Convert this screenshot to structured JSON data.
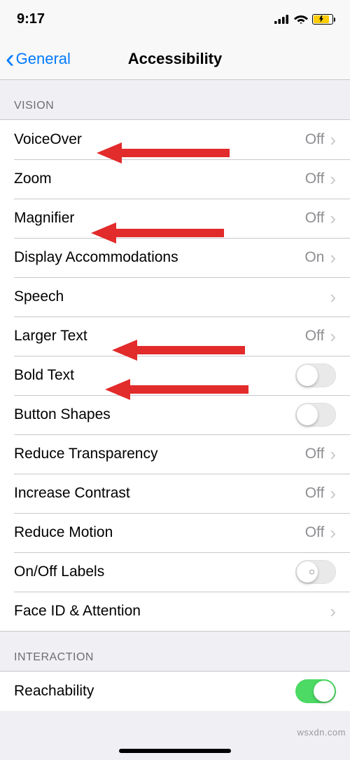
{
  "status": {
    "time": "9:17"
  },
  "nav": {
    "back": "General",
    "title": "Accessibility"
  },
  "sections": {
    "vision": {
      "header": "VISION",
      "voiceover": {
        "label": "VoiceOver",
        "value": "Off"
      },
      "zoom": {
        "label": "Zoom",
        "value": "Off"
      },
      "magnifier": {
        "label": "Magnifier",
        "value": "Off"
      },
      "display_accommodations": {
        "label": "Display Accommodations",
        "value": "On"
      },
      "speech": {
        "label": "Speech"
      },
      "larger_text": {
        "label": "Larger Text",
        "value": "Off"
      },
      "bold_text": {
        "label": "Bold Text"
      },
      "button_shapes": {
        "label": "Button Shapes"
      },
      "reduce_transparency": {
        "label": "Reduce Transparency",
        "value": "Off"
      },
      "increase_contrast": {
        "label": "Increase Contrast",
        "value": "Off"
      },
      "reduce_motion": {
        "label": "Reduce Motion",
        "value": "Off"
      },
      "onoff_labels": {
        "label": "On/Off Labels"
      },
      "faceid": {
        "label": "Face ID & Attention"
      }
    },
    "interaction": {
      "header": "INTERACTION",
      "reachability": {
        "label": "Reachability"
      }
    }
  },
  "watermark": "wsxdn.com"
}
